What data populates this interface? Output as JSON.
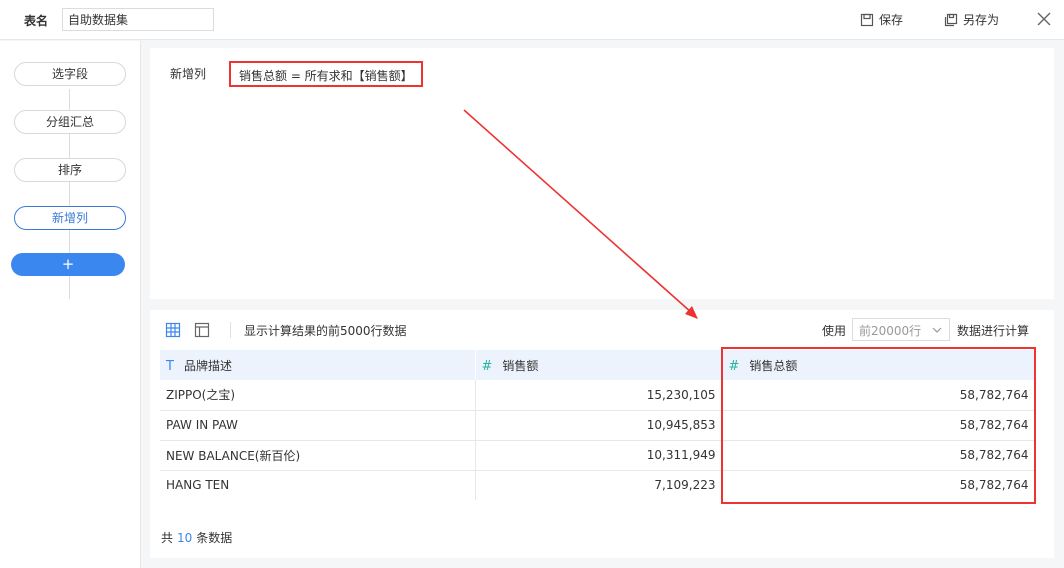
{
  "header": {
    "table_name_label": "表名",
    "table_name_value": "自助数据集",
    "save_label": "保存",
    "save_as_label": "另存为"
  },
  "sidebar": {
    "steps": [
      {
        "label": "选字段"
      },
      {
        "label": "分组汇总"
      },
      {
        "label": "排序"
      },
      {
        "label": "新增列"
      }
    ],
    "active_step": "新增列",
    "add_label": "+"
  },
  "formula": {
    "label": "新增列",
    "expression": "销售总额 = 所有求和【销售额】"
  },
  "data_panel": {
    "info": "显示计算结果的前5000行数据",
    "use_label": "使用",
    "row_limit": "前20000行",
    "calc_label": "数据进行计算",
    "columns": [
      {
        "type_icon": "T",
        "name": "品牌描述"
      },
      {
        "type_icon": "#",
        "name": "销售额"
      },
      {
        "type_icon": "#",
        "name": "销售总额"
      }
    ],
    "rows": [
      [
        "ZIPPO(之宝)",
        "15,230,105",
        "58,782,764"
      ],
      [
        "PAW IN PAW",
        "10,945,853",
        "58,782,764"
      ],
      [
        "NEW BALANCE(新百伦)",
        "10,311,949",
        "58,782,764"
      ],
      [
        "HANG TEN",
        "7,109,223",
        "58,782,764"
      ]
    ],
    "footer_prefix": "共",
    "footer_count": "10",
    "footer_suffix": "条数据"
  },
  "colors": {
    "accent": "#3b87f0",
    "annotation": "#e33333",
    "numeric_icon": "#2bb3a0"
  }
}
